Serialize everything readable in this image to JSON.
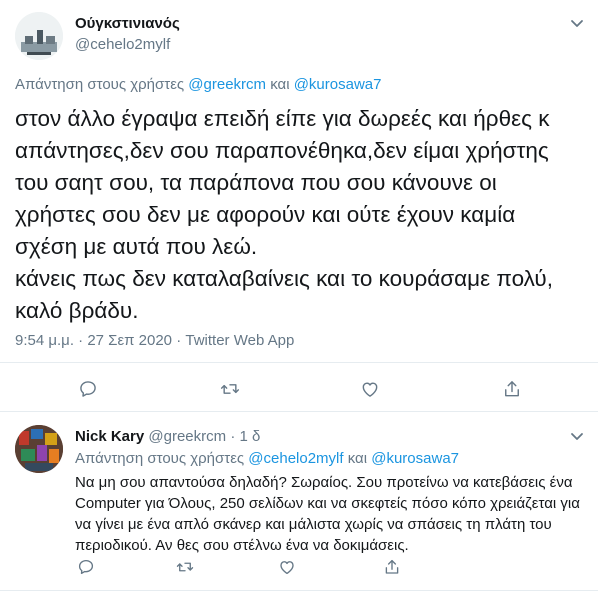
{
  "main_tweet": {
    "display_name": "Ούγκστινιανός",
    "handle": "@cehelo2mylf",
    "reply_prefix": "Απάντηση στους χρήστες",
    "reply_user1": "@greekrcm",
    "reply_and": "και",
    "reply_user2": "@kurosawa7",
    "text": "στον άλλο έγραψα επειδή είπε για δωρεές και ήρθες κ\nαπάντησες,δεν σου παραπονέθηκα,δεν είμαι χρήστης\nτου σαητ σου, τα παράπονα που σου κάνουνε οι\nχρήστες σου δεν με αφορούν και ούτε έχουν καμία\nσχέση με αυτά που λεώ.\nκάνεις πως δεν καταλαβαίνεις και το κουράσαμε πολύ,\nκαλό βράδυ.",
    "time": "9:54 μ.μ.",
    "dot": "·",
    "date": "27 Σεπ 2020",
    "source": "Twitter Web App"
  },
  "reply_tweet": {
    "display_name": "Nick Kary",
    "handle": "@greekrcm",
    "dot": "·",
    "age": "1 δ",
    "reply_prefix": "Απάντηση στους χρήστες",
    "reply_user1": "@cehelo2mylf",
    "reply_and": "και",
    "reply_user2": "@kurosawa7",
    "text": "Να μη σου απαντούσα δηλαδή? Σωραίος. Σου προτείνω να κατεβάσεις ένα Computer για Όλους, 250 σελίδων και να σκεφτείς πόσο κόπο χρειάζεται για να γίνει με ένα απλό σκάνερ και μάλιστα χωρίς να σπάσεις τη πλάτη του περιοδικού. Αν θες σου στέλνω ένα να δοκιμάσεις."
  },
  "icons": {
    "reply": "comment-icon",
    "retweet": "retweet-icon",
    "like": "heart-icon",
    "share": "share-icon",
    "menu": "chevron-down-icon"
  },
  "colors": {
    "link": "#1b95e0",
    "muted": "#657786",
    "text": "#14171a",
    "divider": "#e6ecf0"
  }
}
